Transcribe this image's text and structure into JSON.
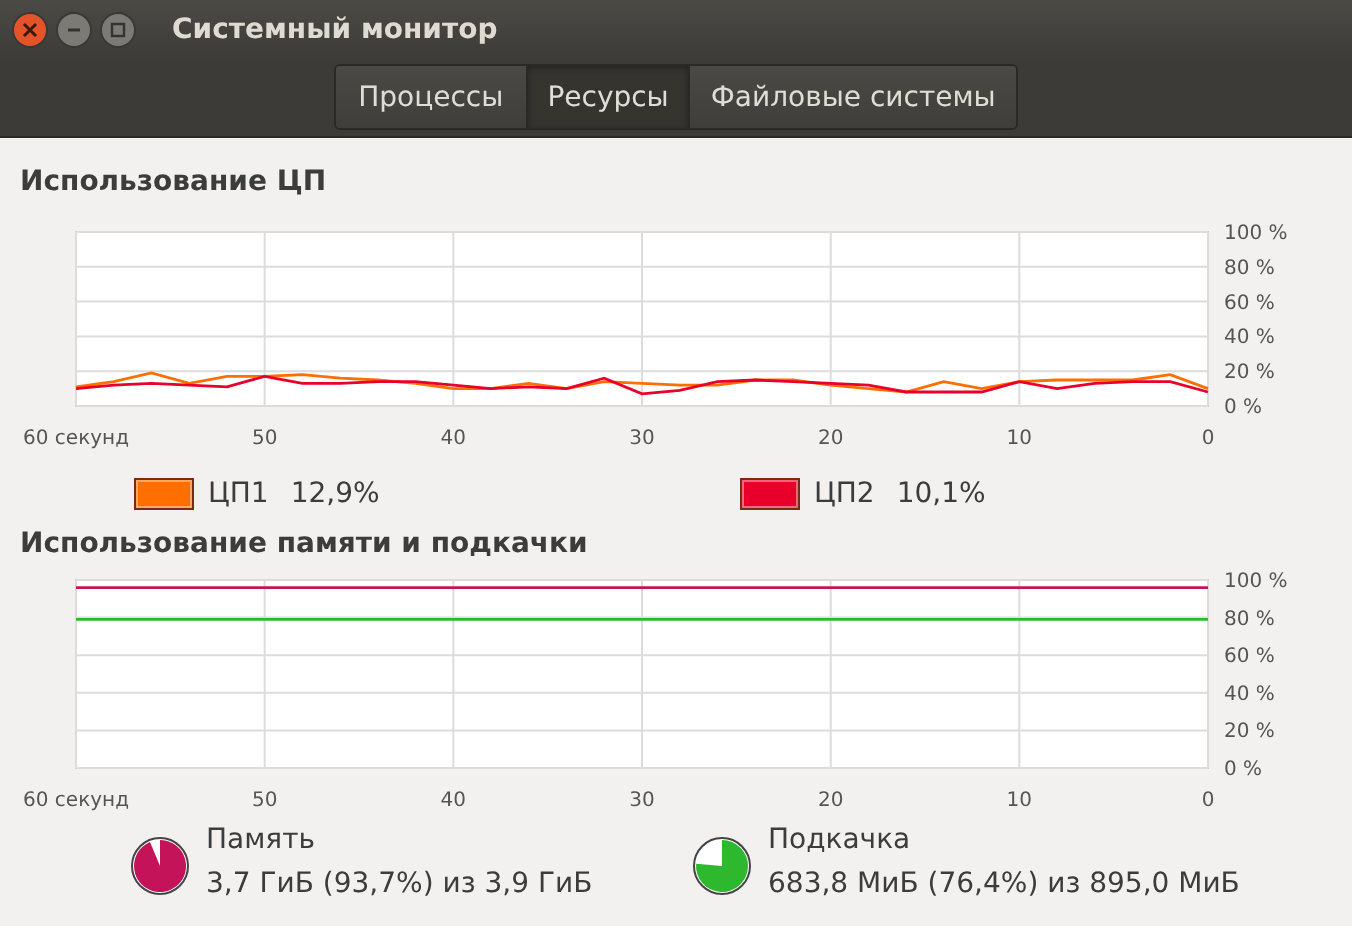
{
  "window": {
    "title": "Системный монитор"
  },
  "tabs": [
    {
      "label": "Процессы",
      "selected": false
    },
    {
      "label": "Ресурсы",
      "selected": true
    },
    {
      "label": "Файловые системы",
      "selected": false
    }
  ],
  "cpu": {
    "title": "Использование ЦП",
    "chart_data": {
      "type": "line",
      "grid": true,
      "x": [
        60,
        58,
        56,
        54,
        52,
        50,
        48,
        46,
        44,
        42,
        40,
        38,
        36,
        34,
        32,
        30,
        28,
        26,
        24,
        22,
        20,
        18,
        16,
        14,
        12,
        10,
        8,
        6,
        4,
        2,
        0
      ],
      "xlim": [
        60,
        0
      ],
      "ylim": [
        0,
        100
      ],
      "xticks": [
        {
          "value": 60,
          "label": "60 секунд"
        },
        {
          "value": 50,
          "label": "50"
        },
        {
          "value": 40,
          "label": "40"
        },
        {
          "value": 30,
          "label": "30"
        },
        {
          "value": 20,
          "label": "20"
        },
        {
          "value": 10,
          "label": "10"
        },
        {
          "value": 0,
          "label": "0"
        }
      ],
      "yticks": [
        {
          "value": 100,
          "label": "100 %"
        },
        {
          "value": 80,
          "label": "80 %"
        },
        {
          "value": 60,
          "label": "60 %"
        },
        {
          "value": 40,
          "label": "40 %"
        },
        {
          "value": 20,
          "label": "20 %"
        },
        {
          "value": 0,
          "label": "0 %"
        }
      ],
      "series": [
        {
          "name": "ЦП1",
          "color": "#ff6f00",
          "values": [
            11,
            14,
            19,
            13,
            17,
            17,
            18,
            16,
            15,
            13,
            10,
            10,
            13,
            10,
            14,
            13,
            12,
            12,
            15,
            15,
            12,
            10,
            8,
            14,
            10,
            14,
            15,
            15,
            15,
            18,
            10
          ]
        },
        {
          "name": "ЦП2",
          "color": "#e8002a",
          "values": [
            10,
            12,
            13,
            12,
            11,
            17,
            13,
            13,
            14,
            14,
            12,
            10,
            11,
            10,
            16,
            7,
            9,
            14,
            15,
            14,
            13,
            12,
            8,
            8,
            8,
            14,
            10,
            13,
            14,
            14,
            8
          ]
        }
      ]
    },
    "legend": [
      {
        "value": "12,9%"
      },
      {
        "value": "10,1%"
      }
    ]
  },
  "memory": {
    "title": "Использование памяти и подкачки",
    "chart_data": {
      "type": "line",
      "grid": true,
      "x": [
        60,
        0
      ],
      "xlim": [
        60,
        0
      ],
      "ylim": [
        0,
        100
      ],
      "xticks": [
        {
          "value": 60,
          "label": "60 секунд"
        },
        {
          "value": 50,
          "label": "50"
        },
        {
          "value": 40,
          "label": "40"
        },
        {
          "value": 30,
          "label": "30"
        },
        {
          "value": 20,
          "label": "20"
        },
        {
          "value": 10,
          "label": "10"
        },
        {
          "value": 0,
          "label": "0"
        }
      ],
      "yticks": [
        {
          "value": 100,
          "label": "100 %"
        },
        {
          "value": 80,
          "label": "80 %"
        },
        {
          "value": 60,
          "label": "60 %"
        },
        {
          "value": 40,
          "label": "40 %"
        },
        {
          "value": 20,
          "label": "20 %"
        },
        {
          "value": 0,
          "label": "0 %"
        }
      ],
      "series": [
        {
          "name": "Память",
          "color": "#c5135a",
          "values": [
            96,
            96
          ]
        },
        {
          "name": "Подкачка",
          "color": "#2eb82e",
          "values": [
            79,
            79
          ]
        }
      ]
    },
    "legend": [
      {
        "detail": "3,7 ГиБ (93,7%) из 3,9 ГиБ"
      },
      {
        "detail": "683,8 МиБ (76,4%) из 895,0 МиБ"
      }
    ]
  }
}
